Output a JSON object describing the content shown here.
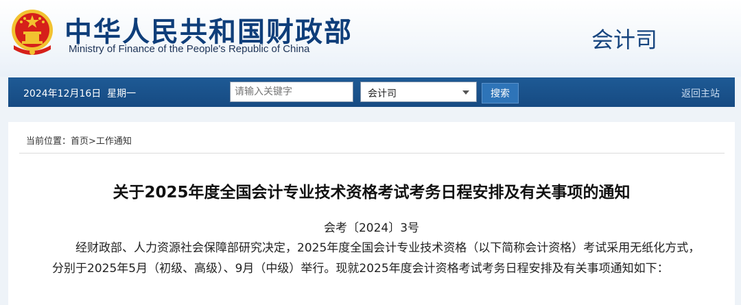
{
  "header": {
    "site_title": "中华人民共和国财政部",
    "site_subtitle": "Ministry of Finance of the People's Republic of China",
    "department": "会计司"
  },
  "navbar": {
    "date": "2024年12月16日  星期一",
    "search_placeholder": "请输入关键字",
    "scope_selected": "会计司",
    "search_label": "搜索",
    "home_link": "返回主站"
  },
  "breadcrumb": {
    "text": "当前位置：首页>工作通知"
  },
  "article": {
    "title": "关于2025年度全国会计专业技术资格考试考务日程安排及有关事项的通知",
    "doc_number": "会考〔2024〕3号",
    "paragraph": "经财政部、人力资源社会保障部研究决定，2025年度全国会计专业技术资格（以下简称会计资格）考试采用无纸化方式，分别于2025年5月（初级、高级）、9月（中级）举行。现就2025年度会计资格考试考务日程安排及有关事项通知如下："
  },
  "colors": {
    "navbar": "#1a5189",
    "title_blue": "#0f3e7a",
    "emblem_red": "#d6201a",
    "emblem_gold": "#f2c230"
  },
  "icons": {
    "emblem": "national-emblem-icon",
    "dropdown": "chevron-down-icon"
  }
}
